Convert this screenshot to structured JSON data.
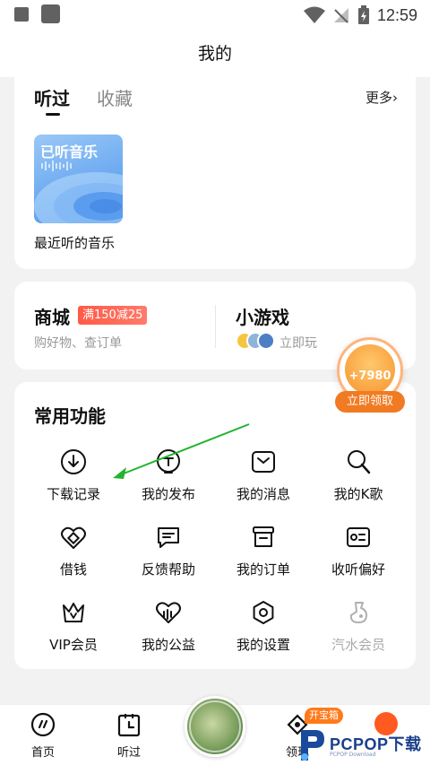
{
  "status_bar": {
    "time": "12:59"
  },
  "header": {
    "title": "我的"
  },
  "history": {
    "tabs": [
      "听过",
      "收藏"
    ],
    "more_label": "更多›",
    "album": {
      "cover_text": "已听音乐",
      "label": "最近听的音乐"
    }
  },
  "shop": {
    "title": "商城",
    "badge": "满150减25",
    "subtitle": "购好物、查订单"
  },
  "games": {
    "title": "小游戏",
    "subtitle": "立即玩"
  },
  "reward": {
    "amount": "+7980",
    "button": "立即领取"
  },
  "functions": {
    "title": "常用功能",
    "items": [
      {
        "label": "下载记录",
        "icon": "download-icon"
      },
      {
        "label": "我的发布",
        "icon": "publish-icon"
      },
      {
        "label": "我的消息",
        "icon": "message-icon"
      },
      {
        "label": "我的K歌",
        "icon": "karaoke-icon"
      },
      {
        "label": "借钱",
        "icon": "loan-icon"
      },
      {
        "label": "反馈帮助",
        "icon": "feedback-icon"
      },
      {
        "label": "我的订单",
        "icon": "order-icon"
      },
      {
        "label": "收听偏好",
        "icon": "preference-icon"
      },
      {
        "label": "VIP会员",
        "icon": "vip-crown-icon"
      },
      {
        "label": "我的公益",
        "icon": "charity-heart-icon"
      },
      {
        "label": "我的设置",
        "icon": "settings-icon"
      },
      {
        "label": "汽水会员",
        "icon": "soda-icon"
      }
    ]
  },
  "bottom_nav": {
    "items": [
      {
        "label": "首页",
        "icon": "home-icon"
      },
      {
        "label": "听过",
        "icon": "history-icon"
      },
      {
        "label": "领现",
        "icon": "cash-icon"
      }
    ],
    "treasure_badge": "开宝箱"
  },
  "watermark": {
    "text": "PCPOP下载",
    "sub": "PCPOP Download"
  },
  "colors": {
    "accent_orange": "#f07b22",
    "badge_red": "#ff5a45",
    "annotation_green": "#22b42e"
  }
}
